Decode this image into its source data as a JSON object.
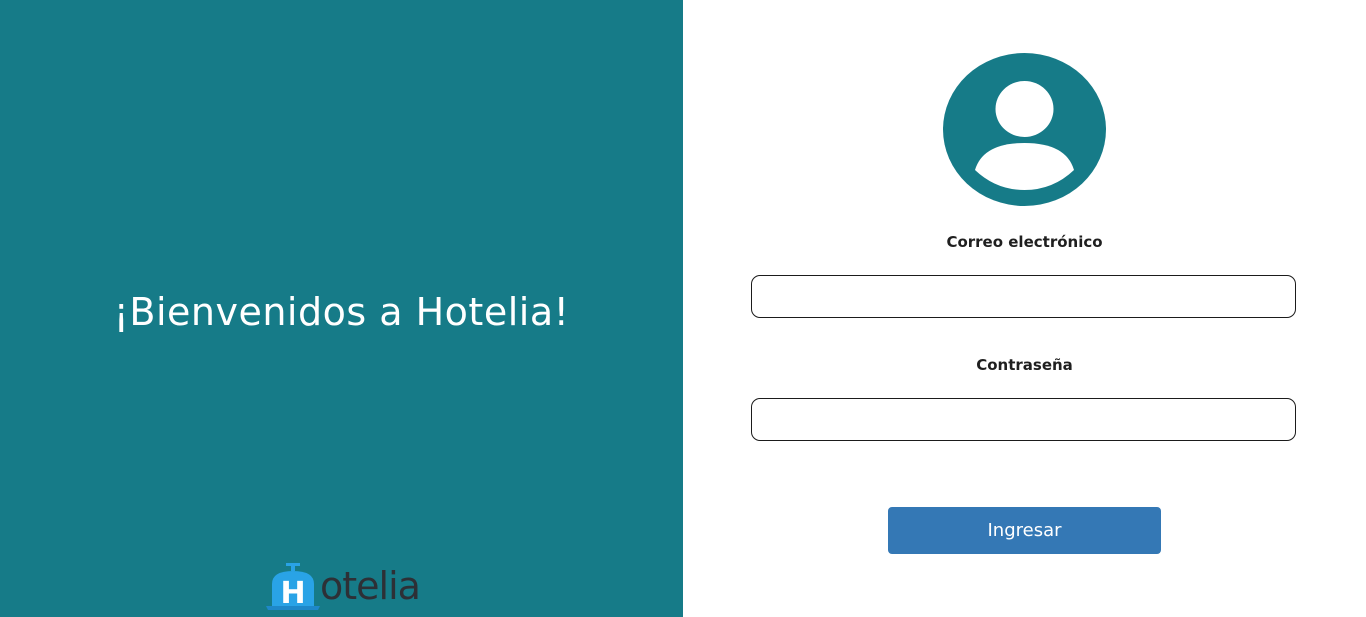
{
  "left_panel": {
    "welcome_title": "¡Bienvenidos a Hotelia!",
    "background_color": "#167b88"
  },
  "logo": {
    "text": "otelia",
    "letter": "H",
    "icon": "hotel-bell-icon",
    "accent_color": "#29a3e6"
  },
  "login_form": {
    "avatar_icon": "user-avatar-icon",
    "email_label": "Correo electrónico",
    "email_value": "",
    "password_label": "Contraseña",
    "password_value": "",
    "submit_label": "Ingresar",
    "button_color": "#3478b5"
  }
}
